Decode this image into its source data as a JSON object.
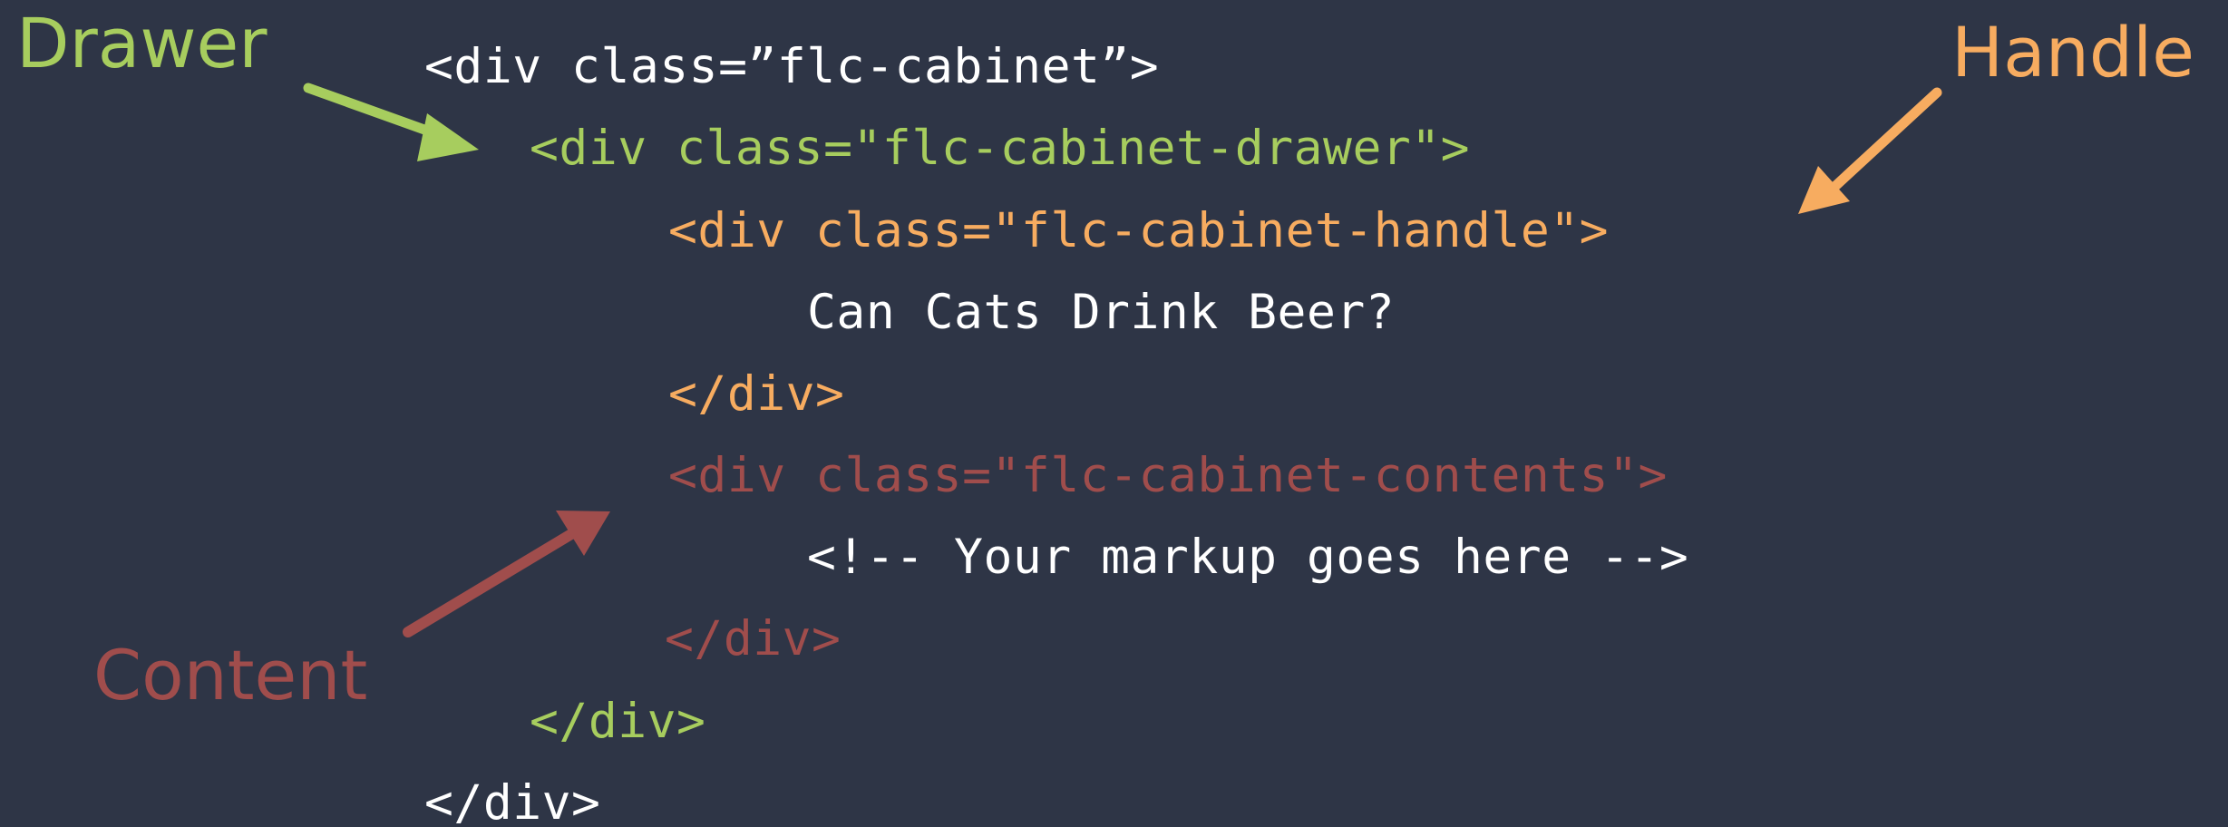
{
  "colors": {
    "background": "#2e3546",
    "code_text": "#ffffff",
    "drawer": "#a7cd5e",
    "handle": "#f7ac60",
    "content": "#a04d4c"
  },
  "labels": {
    "drawer": "Drawer",
    "handle": "Handle",
    "content": "Content"
  },
  "code": {
    "cabinet_open": "<div class=”flc-cabinet”>",
    "drawer_open": "<div class=\"flc-cabinet-drawer\">",
    "handle_open": "<div class=\"flc-cabinet-handle\">",
    "handle_text": "Can Cats Drink Beer?",
    "handle_close": "</div>",
    "contents_open": "<div class=\"flc-cabinet-contents\">",
    "contents_text": "<!-- Your markup goes here -->",
    "contents_close": "</div>",
    "drawer_close": "</div>",
    "cabinet_close": "</div>"
  }
}
